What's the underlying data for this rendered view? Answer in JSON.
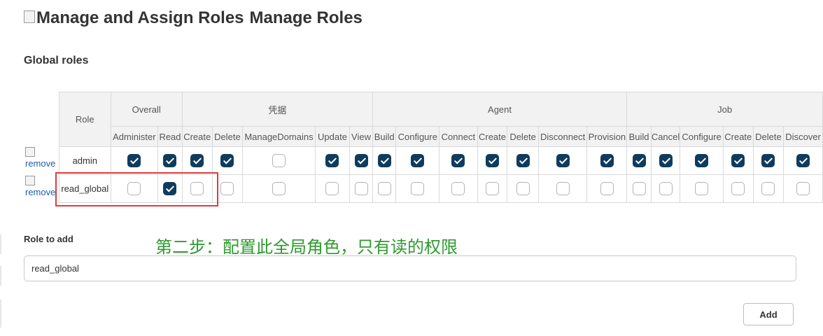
{
  "header": {
    "broken_image_alt": "Manage and Assign Roles",
    "title": "Manage Roles"
  },
  "global_roles": {
    "section_title": "Global roles",
    "role_header": "Role",
    "groups": [
      {
        "name": "Overall",
        "permissions": [
          "Administer",
          "Read"
        ]
      },
      {
        "name": "凭据",
        "permissions": [
          "Create",
          "Delete",
          "ManageDomains",
          "Update",
          "View"
        ]
      },
      {
        "name": "Agent",
        "permissions": [
          "Build",
          "Configure",
          "Connect",
          "Create",
          "Delete",
          "Disconnect",
          "Provision"
        ]
      },
      {
        "name": "Job",
        "permissions": [
          "Build",
          "Cancel",
          "Configure",
          "Create",
          "Delete",
          "Discover"
        ]
      }
    ],
    "rows": [
      {
        "remove_label": "remove",
        "name": "admin",
        "checks": [
          true,
          true,
          true,
          true,
          false,
          true,
          true,
          true,
          true,
          true,
          true,
          true,
          true,
          true,
          true,
          true,
          true,
          true,
          true,
          true
        ]
      },
      {
        "remove_label": "remove",
        "name": "read_global",
        "checks": [
          false,
          true,
          false,
          false,
          false,
          false,
          false,
          false,
          false,
          false,
          false,
          false,
          false,
          false,
          false,
          false,
          false,
          false,
          false,
          false
        ]
      }
    ]
  },
  "annotation": "第二步：配置此全局角色，只有读的权限",
  "role_to_add": {
    "label": "Role to add",
    "value": "read_global",
    "add_button": "Add"
  },
  "colors": {
    "checked": "#0f3c5e",
    "highlight": "#e03b3b",
    "annotation": "#2e9a2e",
    "link": "#1f5ea8"
  }
}
